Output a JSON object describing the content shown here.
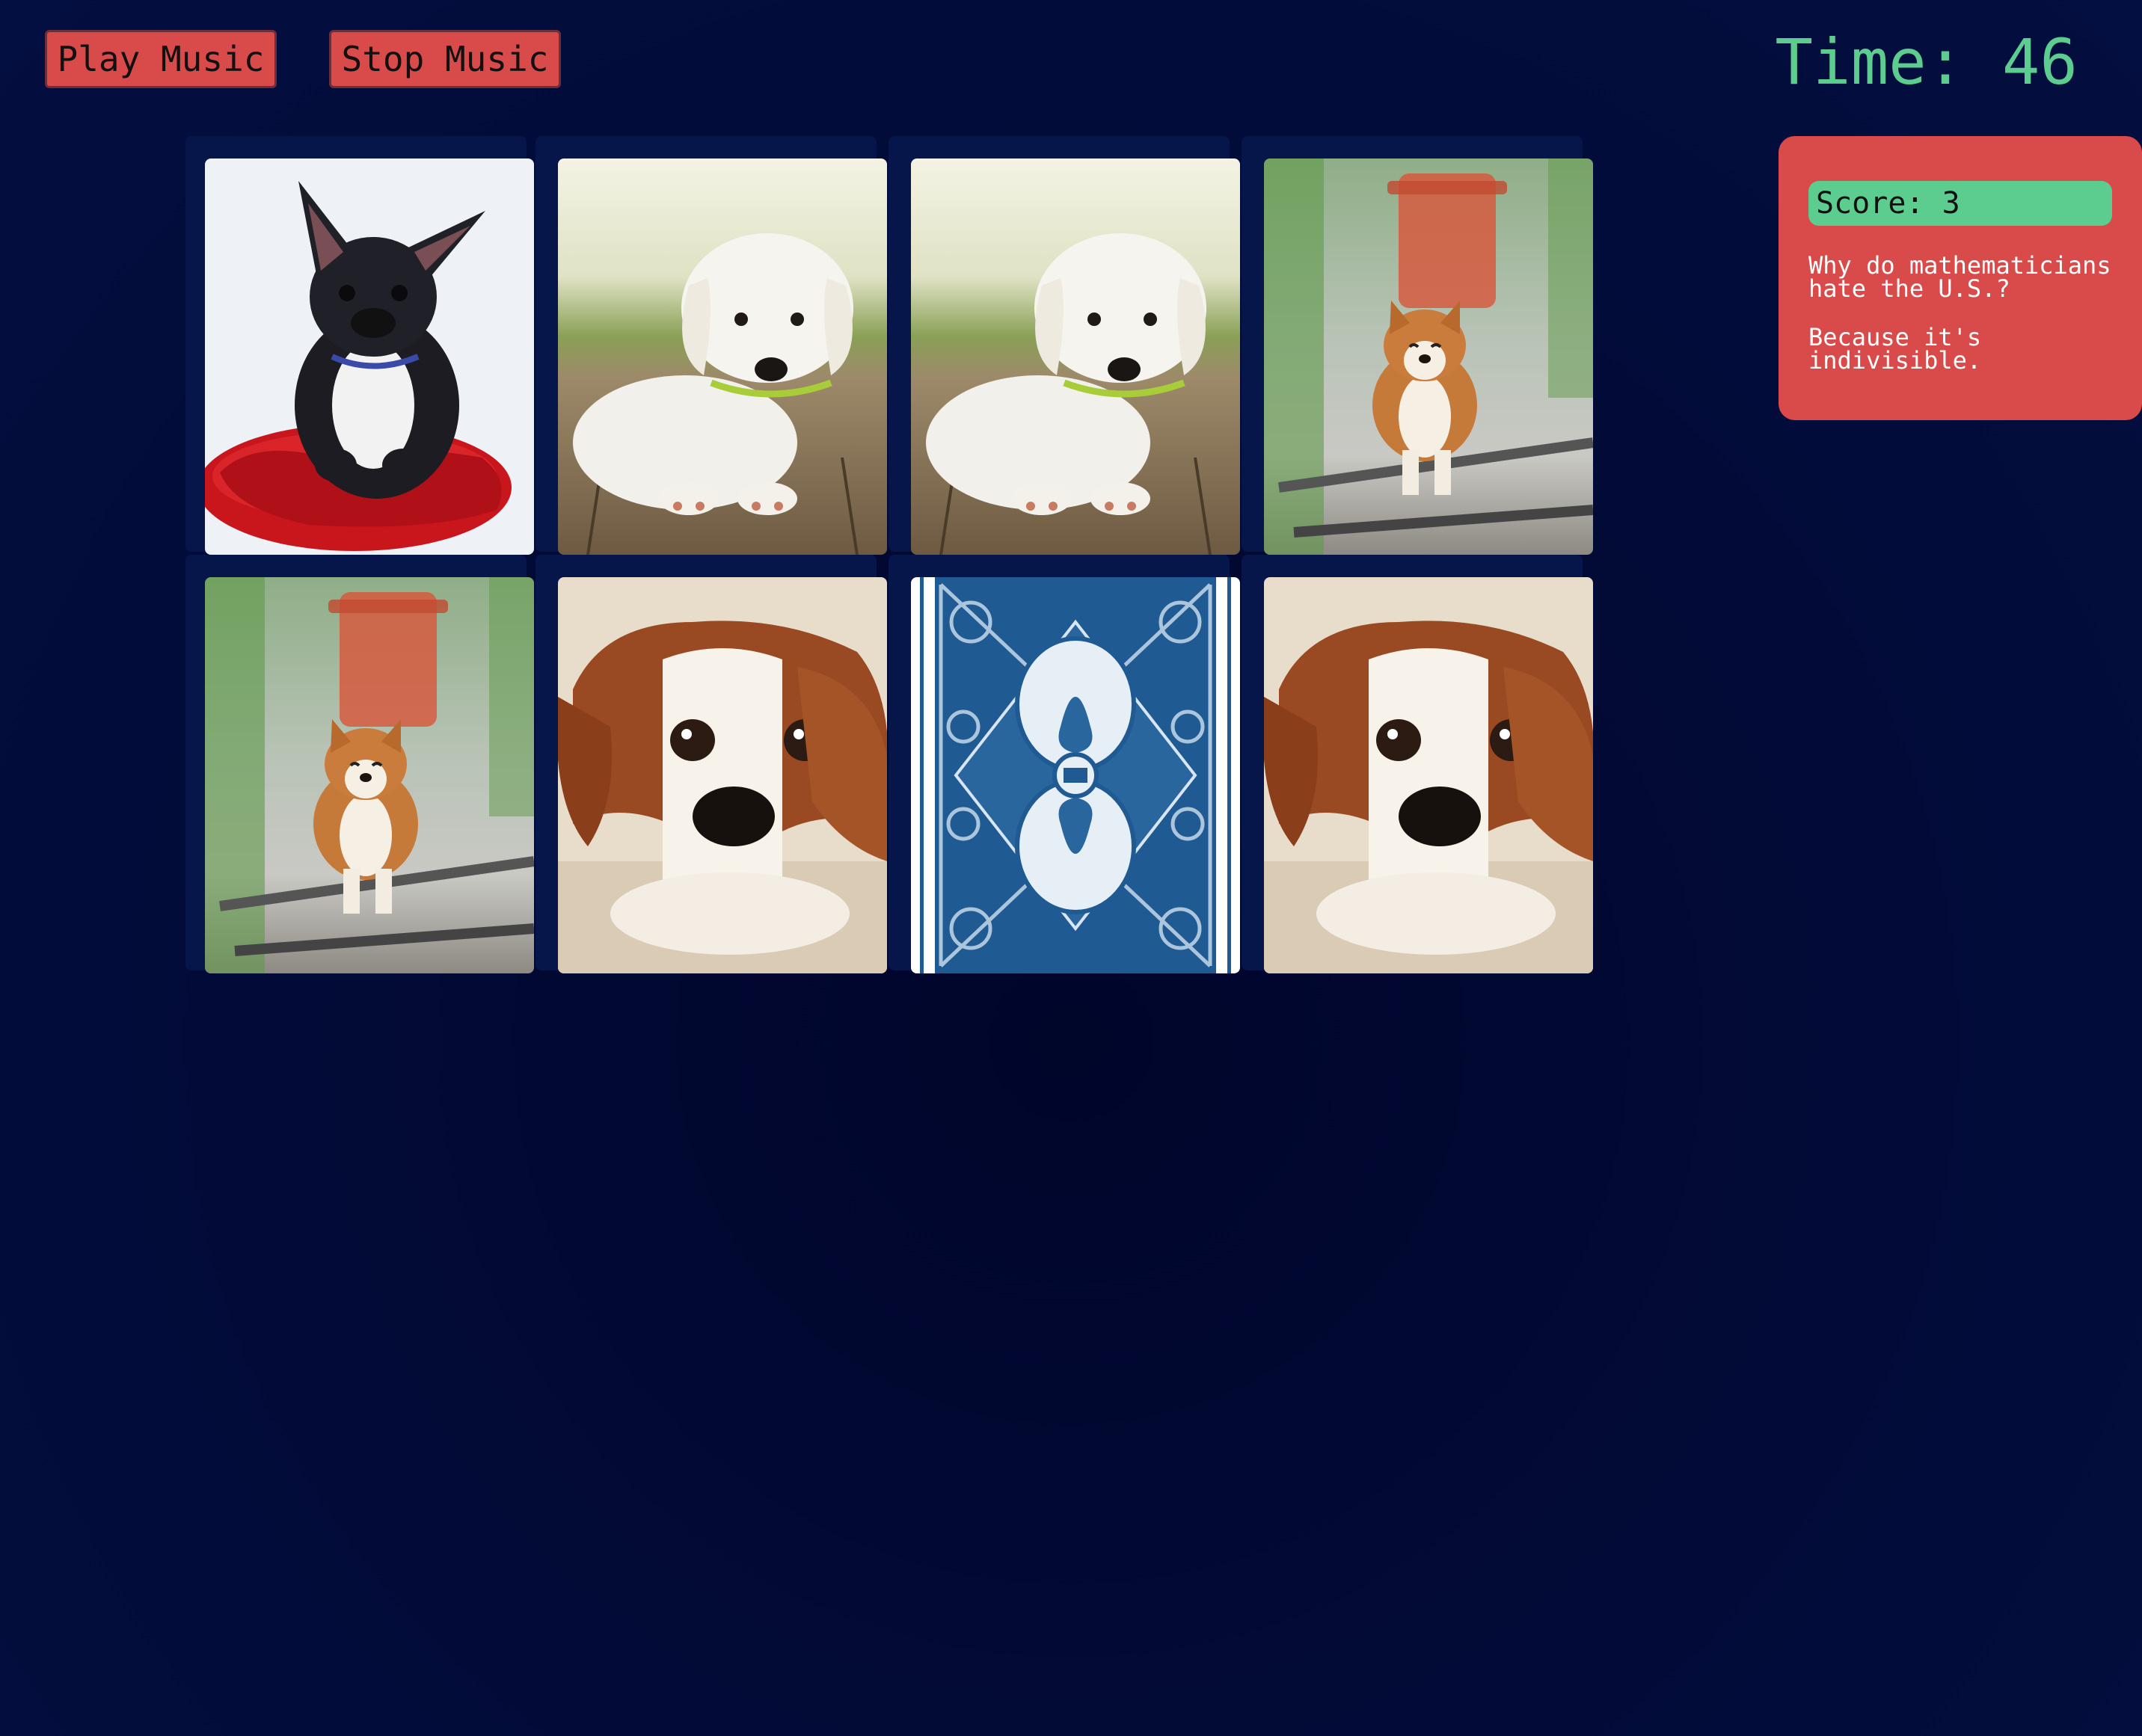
{
  "controls": {
    "play_label": "Play Music",
    "stop_label": "Stop Music"
  },
  "timer": {
    "text": "Time: 46"
  },
  "panel": {
    "score_text": "Score: 3",
    "joke_question": "Why do mathematicians hate the U.S.?",
    "joke_answer": "Because it's indivisible."
  },
  "board": {
    "rows": 2,
    "columns": 4,
    "cards": [
      {
        "row": 1,
        "col": 1,
        "state": "face-up",
        "picture": "black-french-bulldog-on-red-cushion"
      },
      {
        "row": 1,
        "col": 2,
        "state": "face-up",
        "picture": "white-puppy-on-wooden-deck"
      },
      {
        "row": 1,
        "col": 3,
        "state": "face-up",
        "picture": "white-puppy-on-wooden-deck"
      },
      {
        "row": 1,
        "col": 4,
        "state": "face-up",
        "picture": "corgi-on-railway-tracks"
      },
      {
        "row": 2,
        "col": 1,
        "state": "face-up",
        "picture": "corgi-on-railway-tracks"
      },
      {
        "row": 2,
        "col": 2,
        "state": "face-up",
        "picture": "cavalier-spaniel-closeup"
      },
      {
        "row": 2,
        "col": 3,
        "state": "face-down",
        "picture": "blue-card-back-with-basset-hound"
      },
      {
        "row": 2,
        "col": 4,
        "state": "face-up",
        "picture": "cavalier-spaniel-closeup"
      }
    ]
  },
  "colors": {
    "background": "#020b38",
    "button_red": "#d94a4a",
    "accent_green": "#5ccd8f",
    "card_back_blue": "#1f5a92"
  }
}
